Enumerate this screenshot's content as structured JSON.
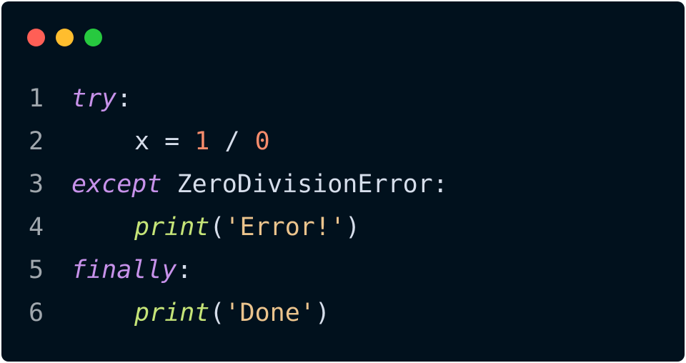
{
  "window": {
    "controls": {
      "close_color": "#ff5f56",
      "minimize_color": "#ffbd2e",
      "maximize_color": "#27c93f"
    },
    "background": "#01111d"
  },
  "code": {
    "lines": [
      {
        "number": "1",
        "t1": "try",
        "t2": ":"
      },
      {
        "number": "2",
        "t1": "x",
        "t2": " = ",
        "t3": "1",
        "t4": " / ",
        "t5": "0"
      },
      {
        "number": "3",
        "t1": "except",
        "t2": " ZeroDivisionError:"
      },
      {
        "number": "4",
        "t1": "print",
        "t2": "(",
        "t3": "'Error!'",
        "t4": ")"
      },
      {
        "number": "5",
        "t1": "finally",
        "t2": ":"
      },
      {
        "number": "6",
        "t1": "print",
        "t2": "(",
        "t3": "'Done'",
        "t4": ")"
      }
    ]
  },
  "colors": {
    "keyword": "#c792ea",
    "function": "#c5e478",
    "number": "#f78c6c",
    "string": "#ecc48d",
    "text": "#d6deeb",
    "line_number": "#a0a7ad"
  }
}
